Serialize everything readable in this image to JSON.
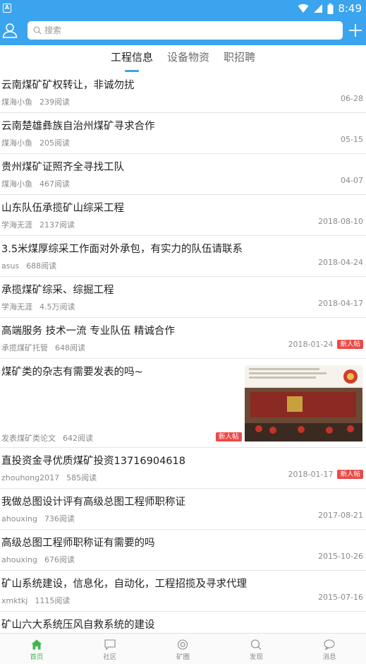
{
  "status_bar": {
    "time": "8:49",
    "left_icon": "A"
  },
  "header": {
    "search_placeholder": "搜索"
  },
  "tabs": [
    {
      "label": "工程信息",
      "active": true
    },
    {
      "label": "设备物资",
      "active": false
    },
    {
      "label": "职招聘",
      "active": false
    }
  ],
  "feed": [
    {
      "title": "云南煤矿矿权转让，非诚勿扰",
      "author": "煤海小鱼",
      "reads": "239阅读",
      "date": "06-28"
    },
    {
      "title": "云南楚雄彝族自治州煤矿寻求合作",
      "author": "煤海小鱼",
      "reads": "205阅读",
      "date": "05-15"
    },
    {
      "title": "贵州煤矿证照齐全寻找工队",
      "author": "煤海小鱼",
      "reads": "467阅读",
      "date": "04-07"
    },
    {
      "title": "山东队伍承揽矿山综采工程",
      "author": "学海无涯",
      "reads": "2137阅读",
      "date": "2018-08-10"
    },
    {
      "title": "3.5米煤厚综采工作面对外承包，有实力的队伍请联系",
      "author": "asus",
      "reads": "688阅读",
      "date": "2018-04-24"
    },
    {
      "title": "承揽煤矿综采、综掘工程",
      "author": "学海无涯",
      "reads": "4.5万阅读",
      "date": "2018-04-17"
    },
    {
      "title": "高端服务 技术一流 专业队伍 精诚合作",
      "author": "承揽煤矿托管",
      "reads": "648阅读",
      "date": "2018-01-24",
      "badge": "新人帖"
    },
    {
      "title": "煤矿类的杂志有需要发表的吗~",
      "author": "发表煤矿类论文",
      "reads": "642阅读",
      "badge": "新人帖"
    },
    {
      "title": "直投资金寻优质煤矿投资13716904618",
      "author": "zhouhong2017",
      "reads": "585阅读",
      "date": "2018-01-17",
      "badge": "新人帖"
    },
    {
      "title": "我做总图设计评有高级总图工程师职称证",
      "author": "ahouxing",
      "reads": "736阅读",
      "date": "2017-08-21"
    },
    {
      "title": "高级总图工程师职称证有需要的吗",
      "author": "ahouxing",
      "reads": "676阅读",
      "date": "2015-10-26"
    },
    {
      "title": "矿山系统建设，信息化，自动化，工程招揽及寻求代理",
      "author": "xmktkj",
      "reads": "1115阅读",
      "date": "2015-07-16"
    },
    {
      "title": "矿山六大系统压风自救系统的建设",
      "author": "",
      "reads": "",
      "date": ""
    }
  ],
  "bottom_nav": [
    {
      "label": "首页",
      "icon": "home-icon",
      "active": true
    },
    {
      "label": "社区",
      "icon": "community-icon",
      "active": false
    },
    {
      "label": "矿圈",
      "icon": "circle-icon",
      "active": false
    },
    {
      "label": "发现",
      "icon": "discover-icon",
      "active": false
    },
    {
      "label": "消息",
      "icon": "message-icon",
      "active": false
    }
  ],
  "colors": {
    "primary": "#3ba4ee",
    "active_nav": "#3bb84a",
    "badge": "#e94b48",
    "tab_indicator": "#39a7e0"
  }
}
